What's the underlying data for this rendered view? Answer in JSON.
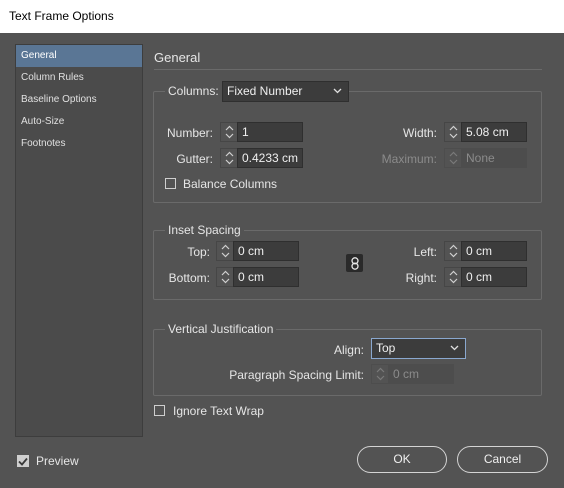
{
  "window": {
    "title": "Text Frame Options"
  },
  "sidebar": {
    "items": [
      {
        "label": "General",
        "selected": true
      },
      {
        "label": "Column Rules"
      },
      {
        "label": "Baseline Options"
      },
      {
        "label": "Auto-Size"
      },
      {
        "label": "Footnotes"
      }
    ]
  },
  "main": {
    "section_title": "General"
  },
  "columns": {
    "label": "Columns:",
    "type_value": "Fixed Number",
    "number_label": "Number:",
    "number_value": "1",
    "gutter_label": "Gutter:",
    "gutter_value": "0.4233 cm",
    "width_label": "Width:",
    "width_value": "5.08 cm",
    "maximum_label": "Maximum:",
    "maximum_value": "None",
    "balance_label": "Balance Columns",
    "balance_checked": false
  },
  "inset": {
    "legend": "Inset Spacing",
    "top_label": "Top:",
    "top_value": "0 cm",
    "bottom_label": "Bottom:",
    "bottom_value": "0 cm",
    "left_label": "Left:",
    "left_value": "0 cm",
    "right_label": "Right:",
    "right_value": "0 cm"
  },
  "vertical": {
    "legend": "Vertical Justification",
    "align_label": "Align:",
    "align_value": "Top",
    "psl_label": "Paragraph Spacing Limit:",
    "psl_value": "0 cm"
  },
  "ignore_wrap": {
    "label": "Ignore Text Wrap",
    "checked": false
  },
  "footer": {
    "preview_label": "Preview",
    "preview_checked": true,
    "ok_label": "OK",
    "cancel_label": "Cancel"
  }
}
